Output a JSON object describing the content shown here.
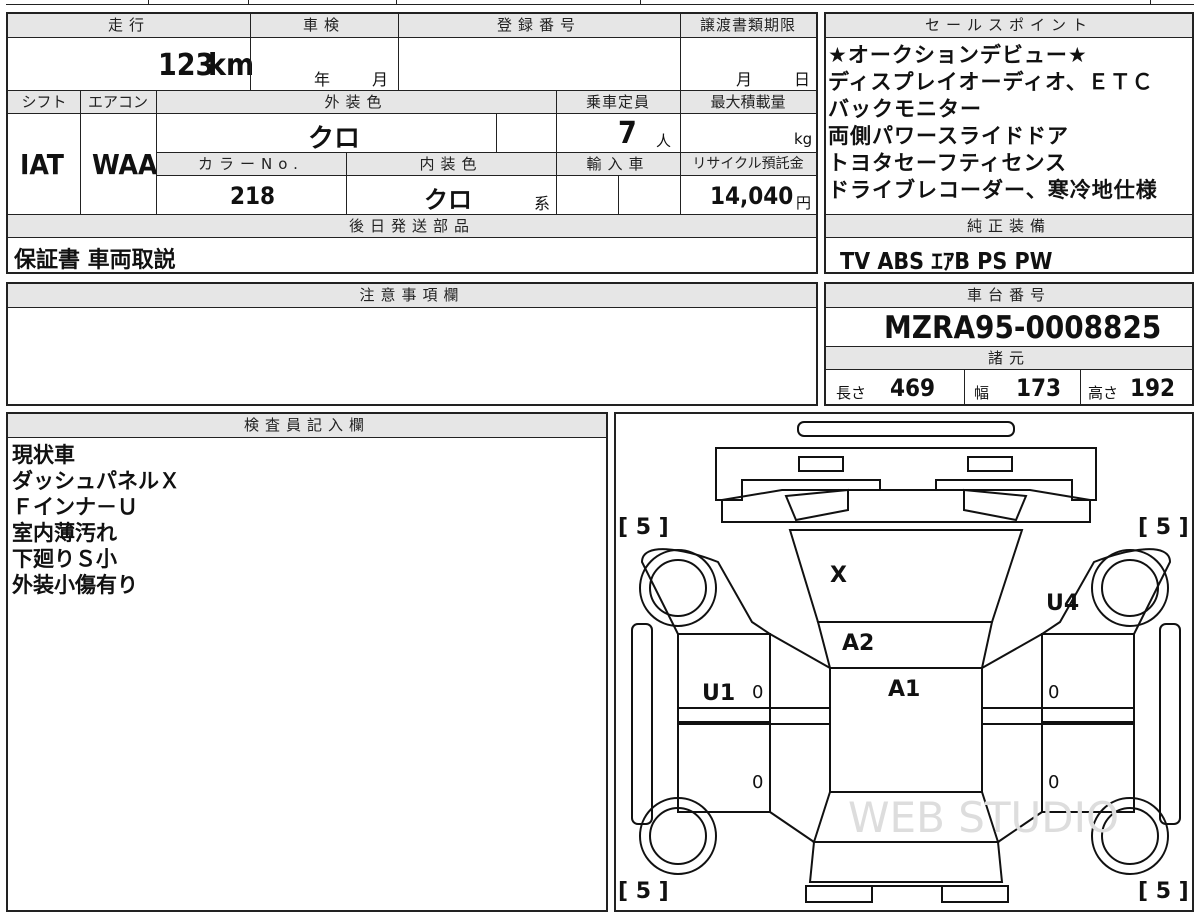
{
  "top": {
    "mileage_label": "走行",
    "mileage_value": "123",
    "mileage_unit": "km",
    "inspection_label": "車検",
    "inspection_year_unit": "年",
    "inspection_month_unit": "月",
    "registration_label": "登録番号",
    "transfer_label": "譲渡書類期限",
    "transfer_month_unit": "月",
    "transfer_day_unit": "日"
  },
  "specs": {
    "shift_label": "シフト",
    "shift_value": "IAT",
    "ac_label": "エアコン",
    "ac_value": "WAA",
    "exterior_label": "外装色",
    "exterior_value": "クロ",
    "capacity_label": "乗車定員",
    "capacity_value": "7",
    "capacity_unit": "人",
    "max_load_label": "最大積載量",
    "max_load_unit": "kg",
    "color_no_label": "カラーNo.",
    "color_no_value": "218",
    "interior_label": "内装色",
    "interior_value": "クロ",
    "interior_suffix": "系",
    "import_label": "輸入車",
    "recycle_label": "リサイクル預託金",
    "recycle_value": "14,040",
    "recycle_unit": "円"
  },
  "later_parts": {
    "label": "後日発送部品",
    "value": "保証書 車両取説"
  },
  "sales_points": {
    "label": "セールスポイント",
    "items": [
      "★オークションデビュー★",
      "ディスプレイオーディオ、ＥＴＣ",
      "バックモニター",
      "両側パワースライドドア",
      "トヨタセーフティセンス",
      "ドライブレコーダー、寒冷地仕様"
    ]
  },
  "genuine_equipment": {
    "label": "純正装備",
    "value": "TV ABS ｴｱB PS PW"
  },
  "caution": {
    "label": "注意事項欄"
  },
  "chassis": {
    "label": "車台番号",
    "value": "MZRA95-0008825"
  },
  "dimensions": {
    "label": "諸元",
    "length_label": "長さ",
    "length_value": "469",
    "width_label": "幅",
    "width_value": "173",
    "height_label": "高さ",
    "height_value": "192"
  },
  "inspector": {
    "label": "検査員記入欄",
    "lines": [
      "現状車",
      "ダッシュパネルＸ",
      "Ｆインナ－Ｕ",
      "室内薄汚れ",
      "下廻りＳ小",
      "外装小傷有り"
    ]
  },
  "diagram": {
    "tire_fl": "[ 5 ]",
    "tire_fr": "[ 5 ]",
    "tire_rl": "[ 5 ]",
    "tire_rr": "[ 5 ]",
    "mark_x": "X",
    "mark_u4": "U4",
    "mark_a2": "A2",
    "mark_a1": "A1",
    "mark_u1": "U1",
    "zero_1": "0",
    "zero_2": "0",
    "zero_3": "0",
    "zero_4": "0",
    "watermark": "WEB STUDIO"
  }
}
